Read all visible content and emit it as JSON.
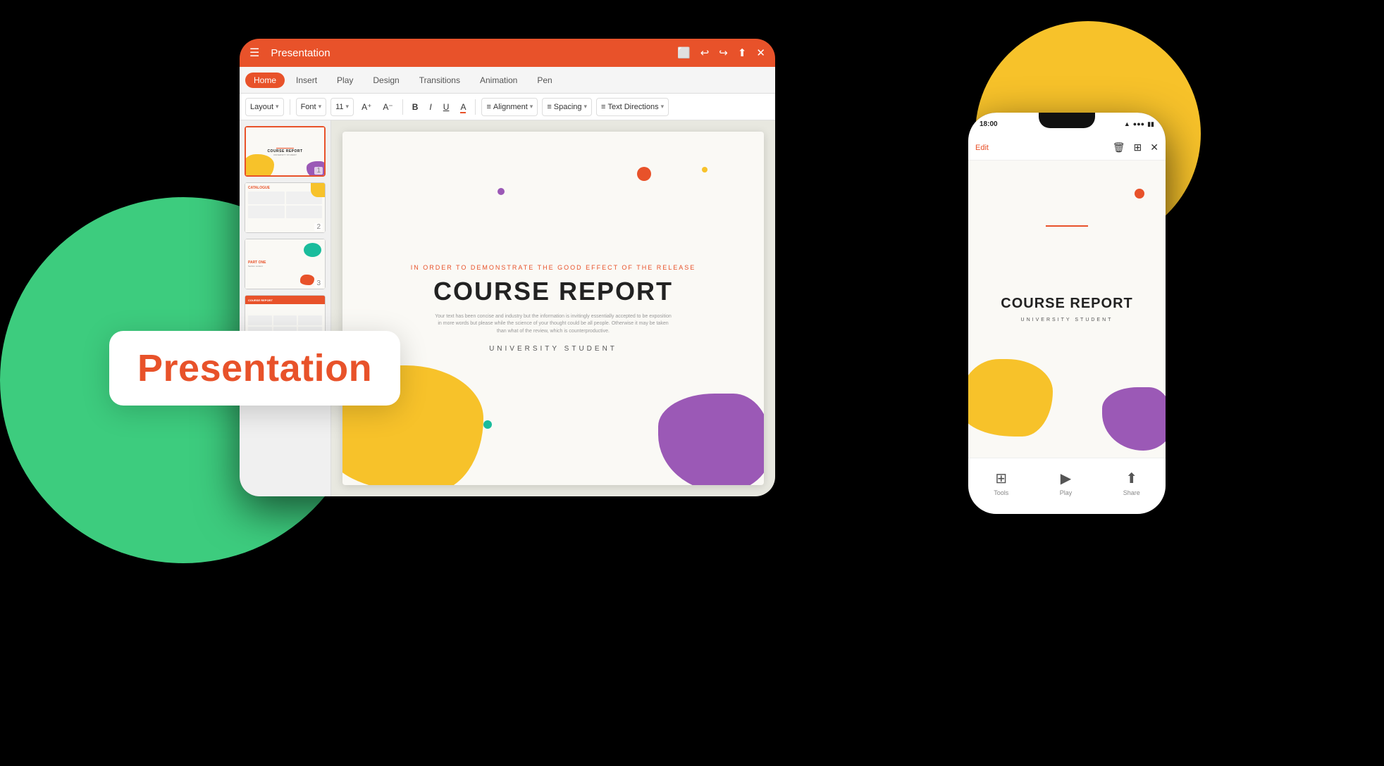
{
  "app": {
    "title": "Presentation",
    "brand_color": "#e8522a",
    "background": "#000000"
  },
  "tablet": {
    "topbar": {
      "title": "Presentation",
      "icons": [
        "⬜",
        "↩",
        "↪",
        "⬆",
        "✕"
      ]
    },
    "tabs": [
      {
        "label": "Home",
        "active": true
      },
      {
        "label": "Insert",
        "active": false
      },
      {
        "label": "Play",
        "active": false
      },
      {
        "label": "Design",
        "active": false
      },
      {
        "label": "Transitions",
        "active": false
      },
      {
        "label": "Animation",
        "active": false
      },
      {
        "label": "Pen",
        "active": false
      }
    ],
    "toolbar": {
      "layout_label": "Layout",
      "font_label": "Font",
      "font_size": "11",
      "buttons": [
        "B",
        "I",
        "U",
        "A"
      ],
      "alignment_label": "Alignment",
      "spacing_label": "Spacing",
      "text_direction_label": "Text Directions"
    }
  },
  "slides": [
    {
      "id": 1,
      "active": true,
      "title": "COURSE REPORT",
      "subtitle": "IN ORDER TO DEMONSTRATE THE GOOD EFFECT OF THE RELEASE",
      "body": "Your text has been concise and industry but the information is invitingly essentially accepted to be exposition in more words but please while the science of your thought could be all people. Otherwise it may be taken than what of the review, which is counterproductive.",
      "student": "UNIVERSITY STUDENT"
    },
    {
      "id": 2,
      "label": "CATALOGUE"
    },
    {
      "id": 3,
      "label": "PART ONE"
    },
    {
      "id": 4,
      "label": "COURSE REPORT"
    }
  ],
  "phone": {
    "status_bar": {
      "time": "18:00",
      "wifi": "▲",
      "signal": "●●●",
      "battery": "▮▮▮"
    },
    "toolbar": {
      "edit_label": "Edit",
      "icons": [
        "🗑",
        "⊞",
        "✕"
      ]
    },
    "slide": {
      "title": "COURSE REPORT",
      "subtitle": "UNIVERSITY STUDENT"
    },
    "bottom_bar": [
      {
        "icon": "⊞",
        "label": "Tools"
      },
      {
        "icon": "▶",
        "label": "Play"
      },
      {
        "icon": "⬆",
        "label": "Share"
      }
    ]
  },
  "presentation_label": "Presentation",
  "decorative": {
    "green_circle_color": "#3dcc7e",
    "yellow_circle_color": "#f7c22a"
  }
}
